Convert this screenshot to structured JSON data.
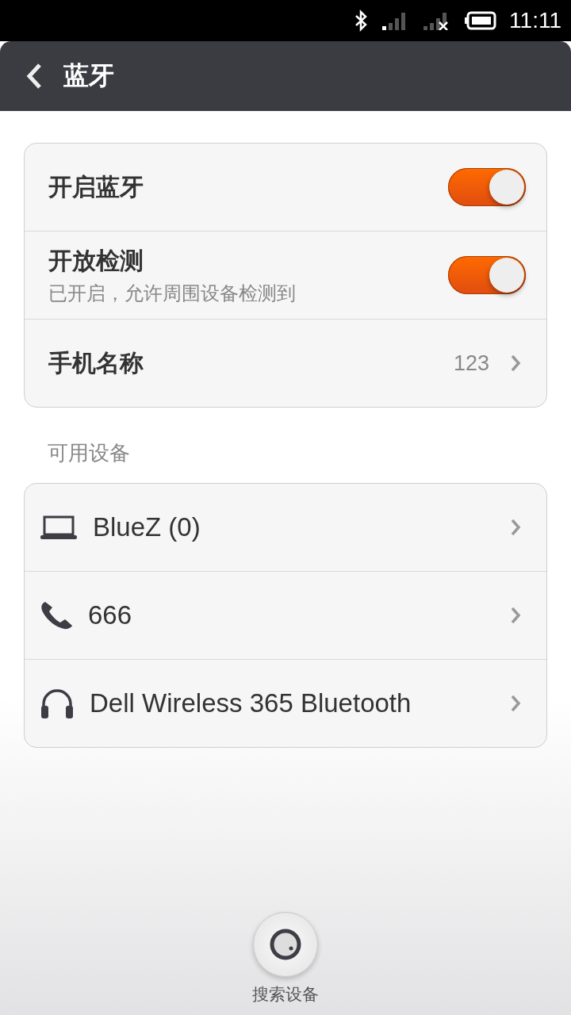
{
  "status_bar": {
    "time": "11:11"
  },
  "header": {
    "title": "蓝牙"
  },
  "settings": [
    {
      "kind": "toggle",
      "label": "开启蓝牙",
      "on": true
    },
    {
      "kind": "toggle",
      "label": "开放检测",
      "sublabel": "已开启，允许周围设备检测到",
      "on": true
    },
    {
      "kind": "link",
      "label": "手机名称",
      "value": "123"
    }
  ],
  "section_title": "可用设备",
  "devices": [
    {
      "kind": "laptop",
      "name": "BlueZ (0)"
    },
    {
      "kind": "phone",
      "name": "666"
    },
    {
      "kind": "headphones",
      "name": "Dell Wireless 365 Bluetooth"
    }
  ],
  "search_button": {
    "label": "搜索设备"
  }
}
